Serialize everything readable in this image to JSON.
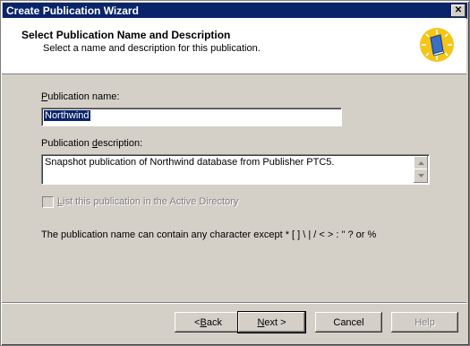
{
  "window": {
    "title": "Create Publication Wizard",
    "close_glyph": "✕"
  },
  "header": {
    "title": "Select Publication Name and Description",
    "subtitle": "Select a name and description for this publication.",
    "icon": "wizard-book-icon"
  },
  "form": {
    "name_label_pre": "",
    "name_label_ul": "P",
    "name_label_post": "ublication name:",
    "name_value": "Northwind",
    "desc_label_pre": "Publication ",
    "desc_label_ul": "d",
    "desc_label_post": "escription:",
    "desc_value": "Snapshot publication of Northwind database from Publisher PTC5.",
    "checkbox_label_pre": "",
    "checkbox_label_ul": "L",
    "checkbox_label_post": "ist this publication in the Active Directory",
    "checkbox_checked": false,
    "hint": "The publication name can contain any character except * [ ] \\ | / < > : \" ? or %"
  },
  "buttons": {
    "back_pre": "< ",
    "back_ul": "B",
    "back_post": "ack",
    "next_ul": "N",
    "next_post": "ext >",
    "cancel": "Cancel",
    "help": "Help"
  }
}
